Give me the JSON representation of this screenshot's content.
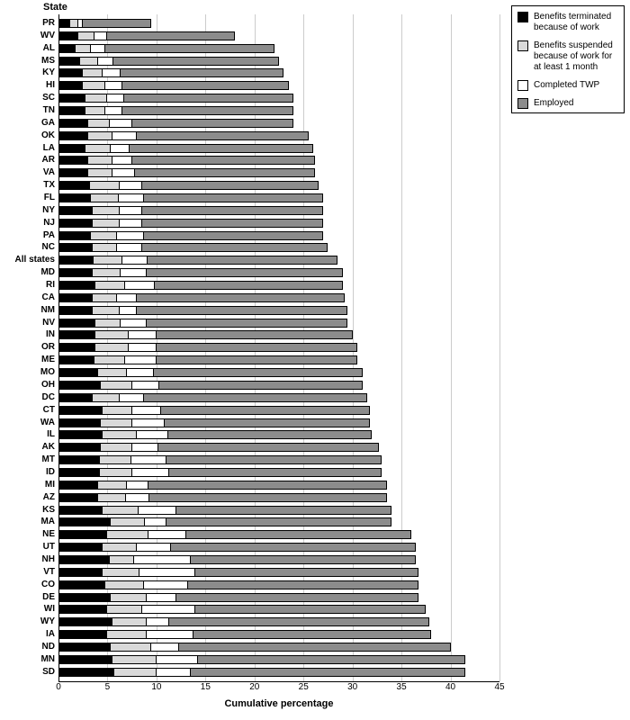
{
  "chart_data": {
    "type": "bar",
    "orientation": "horizontal",
    "stacked": true,
    "y_title": "State",
    "x_title": "Cumulative percentage",
    "xlim": [
      0,
      45
    ],
    "x_ticks": [
      0,
      5,
      10,
      15,
      20,
      25,
      30,
      35,
      40,
      45
    ],
    "legend": [
      "Benefits terminated because of work",
      "Benefits suspended because of work for at least 1 month",
      "Completed TWP",
      "Employed"
    ],
    "categories": [
      "PR",
      "WV",
      "AL",
      "MS",
      "KY",
      "HI",
      "SC",
      "TN",
      "GA",
      "OK",
      "LA",
      "AR",
      "VA",
      "TX",
      "FL",
      "NY",
      "NJ",
      "PA",
      "NC",
      "All states",
      "MD",
      "RI",
      "CA",
      "NM",
      "NV",
      "IN",
      "OR",
      "ME",
      "MO",
      "OH",
      "DC",
      "CT",
      "WA",
      "IL",
      "AK",
      "MT",
      "ID",
      "MI",
      "AZ",
      "KS",
      "MA",
      "NE",
      "UT",
      "NH",
      "VT",
      "CO",
      "DE",
      "WI",
      "WY",
      "IA",
      "ND",
      "MN",
      "SD"
    ],
    "series": [
      {
        "name": "Benefits terminated because of work",
        "values": [
          1.2,
          2.0,
          1.7,
          2.2,
          2.5,
          2.5,
          2.8,
          2.8,
          3.0,
          3.0,
          2.8,
          3.0,
          3.0,
          3.2,
          3.3,
          3.5,
          3.5,
          3.3,
          3.5,
          3.6,
          3.5,
          3.8,
          3.5,
          3.5,
          3.8,
          3.8,
          3.8,
          3.7,
          4.0,
          4.3,
          3.5,
          4.5,
          4.3,
          4.5,
          4.3,
          4.2,
          4.2,
          4.0,
          4.0,
          4.5,
          5.3,
          5.0,
          4.5,
          5.2,
          4.5,
          4.8,
          5.3,
          5.0,
          5.5,
          5.0,
          5.3,
          5.5,
          5.7
        ]
      },
      {
        "name": "Benefits suspended because of work for at least 1 month",
        "values": [
          0.8,
          1.7,
          1.6,
          1.8,
          2.0,
          2.3,
          2.2,
          2.0,
          2.2,
          2.5,
          2.5,
          2.5,
          2.5,
          3.0,
          2.9,
          2.7,
          2.7,
          2.7,
          2.5,
          2.9,
          2.8,
          3.0,
          2.5,
          2.7,
          2.5,
          3.4,
          3.4,
          3.1,
          3.0,
          3.2,
          2.7,
          3.0,
          3.2,
          3.5,
          3.2,
          3.2,
          3.3,
          3.0,
          2.9,
          3.7,
          3.5,
          4.2,
          3.5,
          2.5,
          3.8,
          3.9,
          3.7,
          3.5,
          3.5,
          4.0,
          4.2,
          4.5,
          4.3
        ]
      },
      {
        "name": "Completed TWP",
        "values": [
          0.5,
          1.3,
          1.5,
          1.6,
          1.8,
          1.7,
          1.7,
          1.7,
          2.3,
          2.5,
          2.0,
          2.0,
          2.3,
          2.3,
          2.5,
          2.3,
          2.3,
          2.7,
          2.5,
          2.6,
          2.7,
          3.0,
          2.0,
          1.8,
          2.7,
          2.8,
          2.8,
          3.2,
          2.7,
          2.8,
          2.5,
          3.0,
          3.3,
          3.2,
          2.7,
          3.6,
          3.8,
          2.2,
          2.4,
          3.8,
          2.2,
          3.8,
          3.5,
          5.8,
          5.7,
          4.5,
          3.0,
          5.5,
          2.3,
          4.8,
          2.8,
          4.2,
          3.5
        ]
      },
      {
        "name": "Employed",
        "values": [
          7.0,
          13.0,
          17.2,
          16.9,
          16.7,
          17.0,
          17.3,
          17.5,
          16.5,
          17.5,
          18.7,
          18.7,
          18.4,
          18.0,
          18.3,
          18.5,
          18.5,
          18.3,
          19.0,
          19.4,
          20.0,
          19.2,
          21.2,
          21.5,
          20.5,
          20.0,
          20.5,
          20.5,
          21.3,
          20.7,
          22.8,
          21.3,
          21.0,
          20.8,
          22.5,
          22.0,
          21.7,
          24.3,
          24.2,
          22.0,
          23.0,
          23.0,
          25.0,
          23.0,
          22.7,
          23.5,
          24.7,
          23.5,
          26.5,
          24.2,
          27.7,
          27.3,
          28.0
        ]
      }
    ]
  }
}
